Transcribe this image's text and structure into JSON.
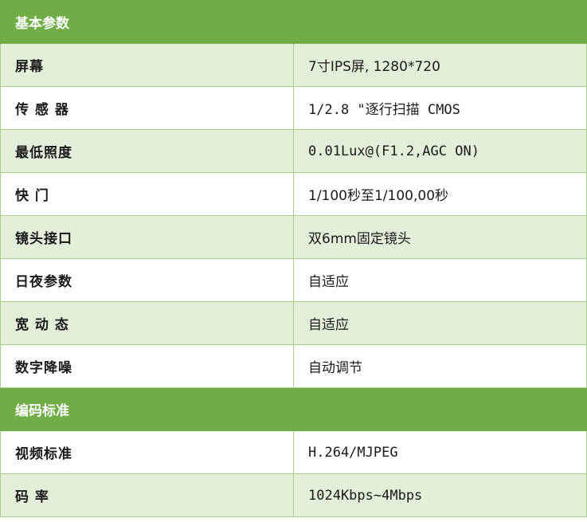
{
  "sections": [
    {
      "title": "基本参数",
      "rows": [
        {
          "label": "屏幕",
          "value": "7寸IPS屏, 1280*720"
        },
        {
          "label": "传 感 器",
          "value": "1/2.8 \"逐行扫描 CMOS"
        },
        {
          "label": "最低照度",
          "value": "0.01Lux@(F1.2,AGC ON)"
        },
        {
          "label": "快    门",
          "value": "1/100秒至1/100,00秒"
        },
        {
          "label": "镜头接口",
          "value": "双6mm固定镜头"
        },
        {
          "label": "日夜参数",
          "value": "自适应"
        },
        {
          "label": "宽 动 态",
          "value": "自适应"
        },
        {
          "label": "数字降噪",
          "value": "自动调节"
        }
      ]
    },
    {
      "title": "编码标准",
      "rows": [
        {
          "label": "视频标准",
          "value": "H.264/MJPEG"
        },
        {
          "label": "码    率",
          "value": "1024Kbps~4Mbps"
        }
      ]
    }
  ]
}
